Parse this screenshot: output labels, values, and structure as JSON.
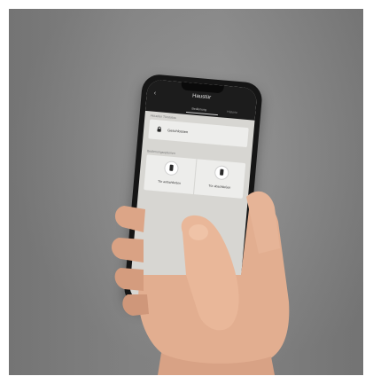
{
  "app": {
    "title": "Haustür",
    "back_icon": "chevron-left-icon",
    "tabs": [
      "Bedienung",
      "Historie"
    ]
  },
  "sections": {
    "status_label": "Aktueller Türstatus",
    "actions_label": "Bedienungsoptionen"
  },
  "status_card": {
    "icon": "lock-icon",
    "label": "Geschlossen"
  },
  "actions": [
    {
      "icon": "door-open-icon",
      "label": "Tür aufschließen"
    },
    {
      "icon": "door-closed-icon",
      "label": "Tür abschließen"
    }
  ],
  "colors": {
    "background": "#8a8a8a",
    "appbar": "#1c1c1c",
    "screen": "#d7d6d2"
  }
}
